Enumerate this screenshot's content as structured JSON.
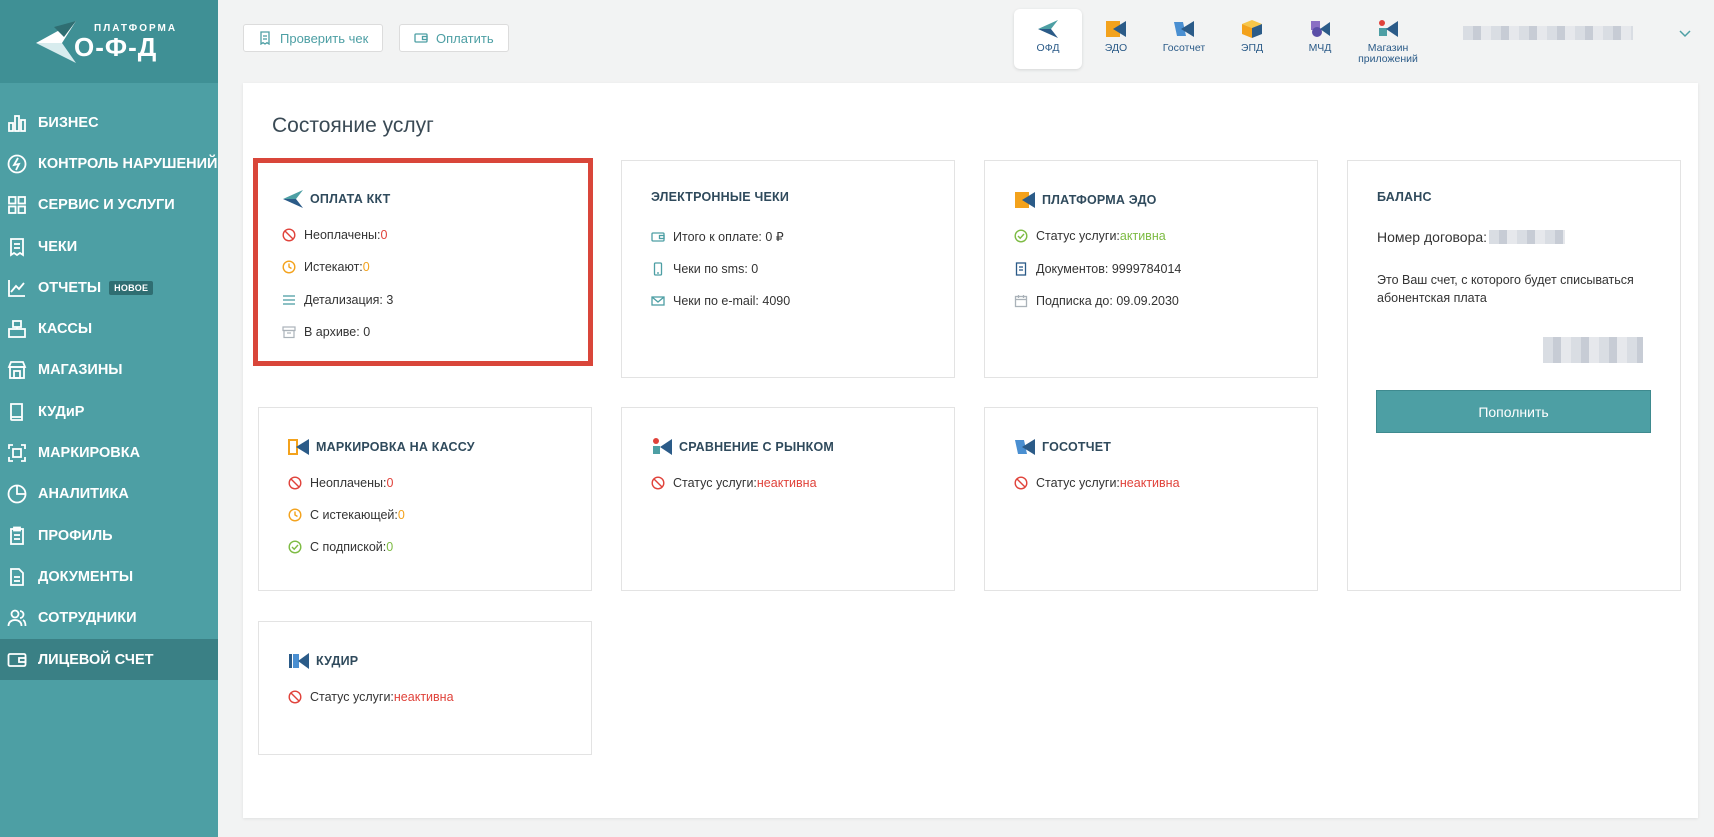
{
  "brand": {
    "small": "ПЛАТФОРМА",
    "big": "О-Ф-Д"
  },
  "sidebar": {
    "items": [
      {
        "label": "БИЗНЕС",
        "icon": "bar-chart-icon"
      },
      {
        "label": "КОНТРОЛЬ НАРУШЕНИЙ",
        "icon": "lightning-icon"
      },
      {
        "label": "СЕРВИС И УСЛУГИ",
        "icon": "grid-icon"
      },
      {
        "label": "ЧЕКИ",
        "icon": "receipt-icon"
      },
      {
        "label": "ОТЧЕТЫ",
        "icon": "chart-line-icon",
        "badge": "НОВОЕ"
      },
      {
        "label": "КАССЫ",
        "icon": "cash-register-icon"
      },
      {
        "label": "МАГАЗИНЫ",
        "icon": "store-icon"
      },
      {
        "label": "КУДиР",
        "icon": "book-icon"
      },
      {
        "label": "МАРКИРОВКА",
        "icon": "scan-icon"
      },
      {
        "label": "АНАЛИТИКА",
        "icon": "pie-chart-icon"
      },
      {
        "label": "ПРОФИЛЬ",
        "icon": "clipboard-icon"
      },
      {
        "label": "ДОКУМЕНТЫ",
        "icon": "document-icon"
      },
      {
        "label": "СОТРУДНИКИ",
        "icon": "users-icon"
      },
      {
        "label": "ЛИЦЕВОЙ СЧЕТ",
        "icon": "wallet-icon",
        "active": true
      }
    ]
  },
  "topbar": {
    "check_label": "Проверить чек",
    "pay_label": "Оплатить",
    "apps": [
      {
        "label": "ОФД",
        "active": true
      },
      {
        "label": "ЭДО"
      },
      {
        "label": "Госотчет"
      },
      {
        "label": "ЭПД"
      },
      {
        "label": "МЧД"
      },
      {
        "label": "Магазин приложений"
      }
    ]
  },
  "main": {
    "title": "Состояние услуг",
    "cards": {
      "kkt": {
        "title": "ОПЛАТА ККТ",
        "unpaid_label": "Неоплачены: ",
        "unpaid_value": "0",
        "expiring_label": "Истекают: ",
        "expiring_value": "0",
        "detail": "Детализация: 3",
        "archive": "В архиве: 0"
      },
      "echeck": {
        "title": "ЭЛЕКТРОННЫЕ ЧЕКИ",
        "total": "Итого к оплате: 0 ₽",
        "sms": "Чеки по sms: 0",
        "email": "Чеки по e-mail: 4090"
      },
      "edo": {
        "title": "ПЛАТФОРМА ЭДО",
        "status_label": "Статус услуги: ",
        "status_value": "активна",
        "docs": "Документов: 9999784014",
        "subscription": "Подписка до: 09.09.2030"
      },
      "balance": {
        "title": "БАЛАНС",
        "contract_label": "Номер договора:",
        "description": "Это Ваш счет, с которого будет списываться абонентская плата",
        "button": "Пополнить"
      },
      "marking": {
        "title": "МАРКИРОВКА НА КАССУ",
        "unpaid_label": "Неоплачены: ",
        "unpaid_value": "0",
        "expiring_label": "С истекающей: ",
        "expiring_value": "0",
        "subscribed_label": "С подпиской: ",
        "subscribed_value": "0"
      },
      "market": {
        "title": "СРАВНЕНИЕ С РЫНКОМ",
        "status_label": "Статус услуги: ",
        "status_value": "неактивна"
      },
      "gos": {
        "title": "ГОСОТЧЕТ",
        "status_label": "Статус услуги: ",
        "status_value": "неактивна"
      },
      "kudir": {
        "title": "КУДИР",
        "status_label": "Статус услуги: ",
        "status_value": "неактивна"
      }
    }
  },
  "colors": {
    "accent": "#4d9fa4",
    "sidebar_active": "#3a8085",
    "error": "#e0423a",
    "warning": "#f3a21c",
    "success": "#7dbb43",
    "highlight": "#d9463a"
  }
}
